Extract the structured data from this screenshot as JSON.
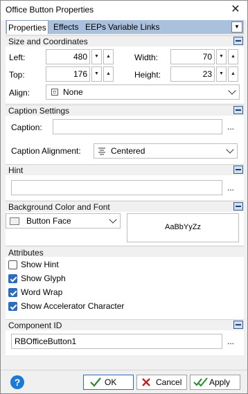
{
  "window": {
    "title": "Office Button Properties",
    "close_glyph": "✕"
  },
  "tabs": [
    {
      "label": "Properties",
      "active": true
    },
    {
      "label": "Effects",
      "active": false
    },
    {
      "label": "EEPs",
      "active": false
    },
    {
      "label": "Variable Links",
      "active": false
    }
  ],
  "sections": {
    "size": {
      "title": "Size and Coordinates",
      "left_label": "Left:",
      "left_value": "480",
      "width_label": "Width:",
      "width_value": "70",
      "top_label": "Top:",
      "top_value": "176",
      "height_label": "Height:",
      "height_value": "23",
      "align_label": "Align:",
      "align_value": "None"
    },
    "caption": {
      "title": "Caption Settings",
      "caption_label": "Caption:",
      "caption_value": "",
      "alignment_label": "Caption Alignment:",
      "alignment_value": "Centered"
    },
    "hint": {
      "title": "Hint",
      "hint_value": ""
    },
    "background": {
      "title": "Background Color and Font",
      "color_value": "Button Face",
      "font_preview": "AaBbYyZz"
    },
    "attributes": {
      "title": "Attributes",
      "items": [
        {
          "label": "Show Hint",
          "checked": false
        },
        {
          "label": "Show Glyph",
          "checked": true
        },
        {
          "label": "Word Wrap",
          "checked": true
        },
        {
          "label": "Show Accelerator Character",
          "checked": true
        }
      ]
    },
    "component": {
      "title": "Component ID",
      "value": "RBOfficeButton1"
    }
  },
  "ellipsis": "...",
  "buttons": {
    "ok": "OK",
    "cancel": "Cancel",
    "apply": "Apply"
  },
  "help_glyph": "?",
  "colors": {
    "accent": "#2b6bc0",
    "tabstrip": "#a9c1dd",
    "ok_check": "#2a8a2a",
    "cancel_x": "#c0202a"
  }
}
